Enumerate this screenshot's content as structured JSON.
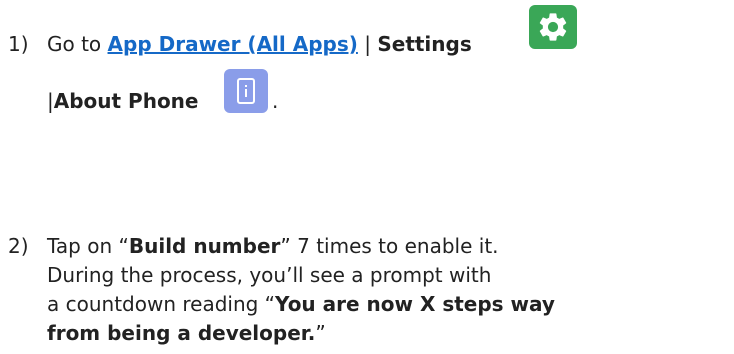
{
  "step1": {
    "number": "1)",
    "prefix": "Go to ",
    "link": "App Drawer (All Apps)",
    "separator1": " | ",
    "settings": "Settings",
    "separator2": "|",
    "about_phone": "About Phone",
    "trailing": "."
  },
  "step2": {
    "number": "2)",
    "text_before": "Tap on “",
    "build_number": "Build number",
    "text_after": "” 7 times to enable it.",
    "line2": "During the process, you’ll see a prompt with",
    "line3_prefix": "a countdown reading “",
    "line3_bold": "You are now X steps way",
    "line4_bold": "from being a developer.",
    "line4_suffix": "”"
  },
  "icons": {
    "settings": "gear-icon",
    "about_phone": "phone-info-icon"
  },
  "colors": {
    "link": "#1569c7",
    "settings_icon_bg": "#3aa757",
    "phone_icon_bg": "#8a9de9"
  }
}
